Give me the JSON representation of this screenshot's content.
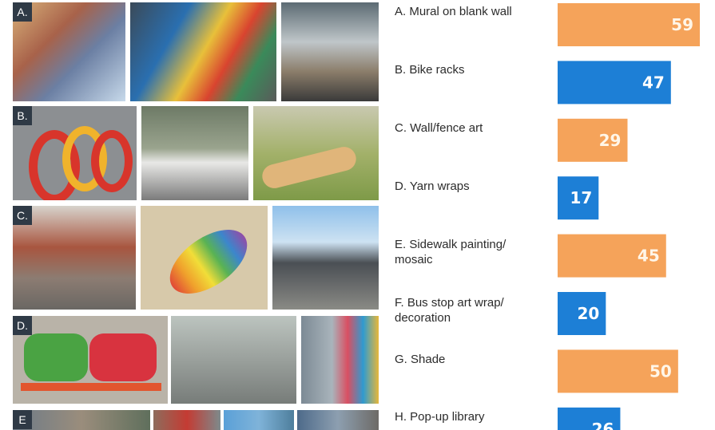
{
  "photo_groups": [
    {
      "letter": "A.",
      "photos": [
        "colorful-mural-building",
        "abstract-dragon-mural",
        "painted-mural-storefront"
      ]
    },
    {
      "letter": "B.",
      "photos": [
        "red-ring-bike-rack",
        "people-at-counter",
        "spoon-shaped-bike-rack"
      ]
    },
    {
      "letter": "C.",
      "photos": [
        "brick-wall-art",
        "paint-splash-wall",
        "fence-with-art"
      ]
    },
    {
      "letter": "D.",
      "photos": [
        "monster-bench-yarn",
        "yarn-wrapped-racks",
        "colorful-building-yarn"
      ]
    },
    {
      "letter": "E",
      "photos": [
        "street-crowd",
        "market-scene",
        "plaza-scene",
        "street-corner"
      ]
    }
  ],
  "chart_data": {
    "type": "bar",
    "orientation": "horizontal",
    "categories": [
      "A. Mural on blank wall",
      "B. Bike racks",
      "C. Wall/fence art",
      "D. Yarn wraps",
      "E. Sidewalk painting/\nmosaic",
      "F. Bus stop art wrap/\ndecoration",
      "G. Shade",
      "H. Pop-up library"
    ],
    "values": [
      59,
      47,
      29,
      17,
      45,
      20,
      50,
      26
    ],
    "colors": [
      "#f5a35a",
      "#1d7fd6",
      "#f5a35a",
      "#1d7fd6",
      "#f5a35a",
      "#1d7fd6",
      "#f5a35a",
      "#1d7fd6"
    ],
    "value_label_colors": [
      "#fff6e8",
      "#ffffff",
      "#fff6e8",
      "#ffffff",
      "#fff6e8",
      "#ffffff",
      "#fff6e8",
      "#ffffff"
    ],
    "xlim": [
      0,
      59
    ],
    "grid": false,
    "legend": "none"
  }
}
